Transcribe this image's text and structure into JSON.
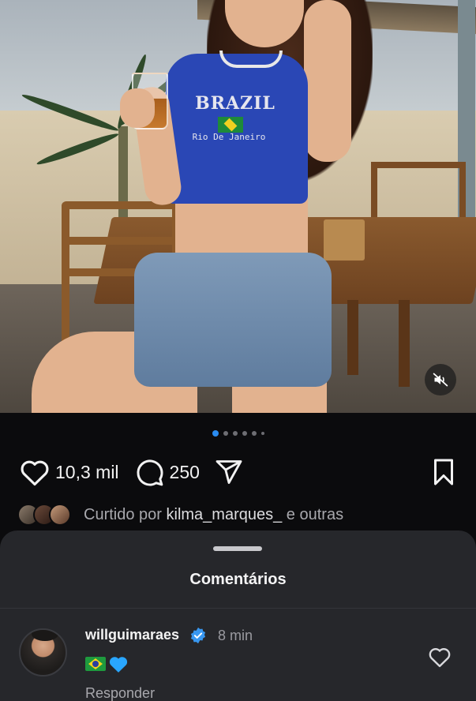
{
  "post": {
    "photo": {
      "shirt_title": "BRAZIL",
      "shirt_subtitle": "Rio De Janeiro",
      "mute_icon": "speaker-muted-icon"
    },
    "carousel": {
      "total": 6,
      "active_index": 0
    },
    "actions": {
      "likes_count": "10,3 mil",
      "comments_count": "250",
      "icons": [
        "heart-icon",
        "comment-icon",
        "send-icon",
        "bookmark-icon"
      ]
    },
    "liked_by": {
      "prefix": "Curtido por",
      "user": "kilma_marques_",
      "suffix": "e outras"
    }
  },
  "comments_sheet": {
    "title": "Comentários",
    "comments": [
      {
        "username": "willguimaraes",
        "verified": true,
        "time": "8 min",
        "text_emoji": "🇧🇷💙",
        "reply_label": "Responder"
      }
    ]
  },
  "colors": {
    "background": "#0b0b0d",
    "sheet": "#26272b",
    "accent_blue": "#2a8cf0",
    "verified_blue": "#3897f0"
  }
}
